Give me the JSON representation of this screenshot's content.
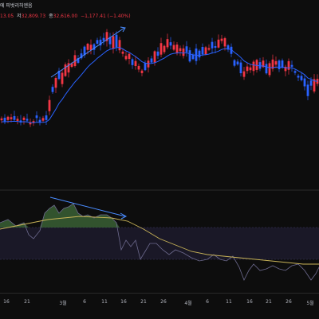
{
  "header": {
    "title_fragment": "에 피벗리허엔음",
    "ohlc": [
      {
        "label": "",
        "value": "13.05"
      },
      {
        "label": "저",
        "value": "32,809.73"
      },
      {
        "label": "종",
        "value": "32,616.00"
      },
      {
        "label": "",
        "value": "−1,177.41 (−1.40%)"
      }
    ]
  },
  "colors": {
    "up": "#f23645",
    "down": "#2962ff",
    "ma_line": "#2962ff",
    "osc_line": "#6d6a8e",
    "signal_line": "#c9b458",
    "overbought_fill": "#3f6b3a",
    "oversold_band": "#1a1827",
    "annotation": "#4a8cff"
  },
  "time_axis": {
    "ticks": [
      "16",
      "21",
      "3월",
      "6",
      "11",
      "16",
      "21",
      "26",
      "4월",
      "6",
      "11",
      "16",
      "21",
      "26",
      "5월"
    ]
  }
}
